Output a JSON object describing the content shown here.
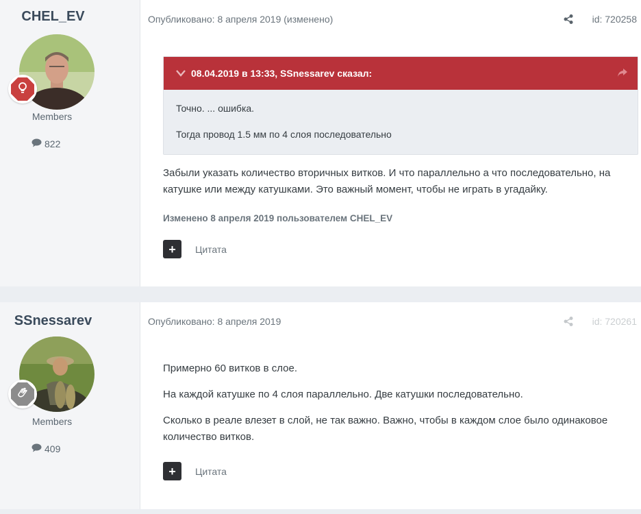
{
  "posts": [
    {
      "author": "CHEL_EV",
      "group": "Members",
      "post_count": "822",
      "published": "Опубликовано: 8 апреля 2019 (изменено)",
      "id": "id: 720258",
      "rank_color": "#c9403f",
      "quote": {
        "header": "08.04.2019 в 13:33, SSnessarev сказал:",
        "lines": [
          "Точно. ... ошибка.",
          "Тогда провод 1.5 мм по 4 слоя последовательно"
        ]
      },
      "body": [
        "Забыли указать количество вторичных витков. И что параллельно а что последовательно, на катушке или между катушками. Это важный момент, чтобы не играть в угадайку."
      ],
      "edited": "Изменено 8 апреля 2019 пользователем CHEL_EV",
      "quote_label": "Цитата"
    },
    {
      "author": "SSnessarev",
      "group": "Members",
      "post_count": "409",
      "published": "Опубликовано: 8 апреля 2019",
      "id": "id: 720261",
      "rank_color": "#8c8c8c",
      "body": [
        "Примерно 60 витков в слое.",
        "На каждой катушке по 4 слоя параллельно. Две катушки последовательно.",
        "Сколько в реале влезет в слой, не так важно. Важно, чтобы в каждом слое было одинаковое количество витков."
      ],
      "quote_label": "Цитата"
    }
  ]
}
